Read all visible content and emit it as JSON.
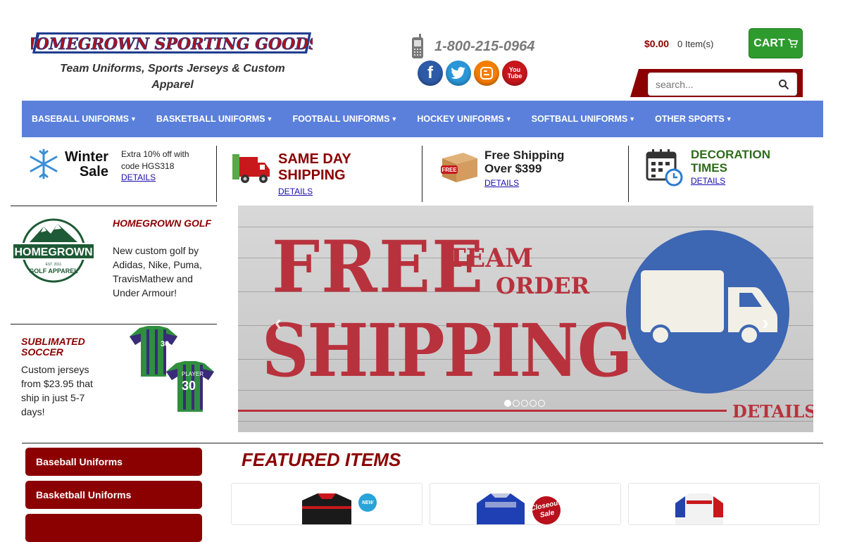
{
  "header": {
    "logo_text": "HOMEGROWN SPORTING GOODS",
    "tagline": "Team Uniforms, Sports Jerseys & Custom Apparel",
    "phone": "1-800-215-0964",
    "social": [
      {
        "name": "facebook",
        "glyph": "f"
      },
      {
        "name": "twitter",
        "glyph": "t"
      },
      {
        "name": "blogger",
        "glyph": "B"
      },
      {
        "name": "youtube",
        "glyph": "You Tube"
      }
    ],
    "cart_total": "$0.00",
    "cart_items": "0 Item(s)",
    "cart_label": "CART",
    "search_placeholder": "search..."
  },
  "nav": {
    "items": [
      {
        "label": "BASEBALL UNIFORMS"
      },
      {
        "label": "BASKETBALL UNIFORMS"
      },
      {
        "label": "FOOTBALL UNIFORMS"
      },
      {
        "label": "HOCKEY UNIFORMS"
      },
      {
        "label": "SOFTBALL UNIFORMS"
      },
      {
        "label": "OTHER SPORTS"
      }
    ]
  },
  "promos": {
    "winter": {
      "title": "Winter Sale",
      "text": "Extra 10% off with code HGS318",
      "link": "DETAILS"
    },
    "sameday": {
      "title": "SAME DAY SHIPPING",
      "link": "DETAILS"
    },
    "freeship": {
      "title": "Free Shipping Over $399",
      "link": "DETAILS",
      "box_label": "FREE"
    },
    "deco": {
      "title": "DECORATION TIMES",
      "link": "DETAILS"
    }
  },
  "left_promos": {
    "golf": {
      "title": "HOMEGROWN GOLF",
      "text": "New custom golf by Adidas, Nike, Puma, TravisMathew and Under Armour!",
      "logo_text": "HOMEGROWN",
      "logo_sub": "GOLF APPAREL",
      "logo_est": "EST. 2011"
    },
    "soccer": {
      "title": "SUBLIMATED SOCCER",
      "text": "Custom jerseys from $23.95 that ship in just 5-7 days!",
      "jersey_number": "30",
      "jersey_name": "PLAYER"
    }
  },
  "hero": {
    "line1": "FREE",
    "line2": "TEAM",
    "line3": "ORDER",
    "line4": "SHIPPING",
    "details": "DETAILS",
    "prev": "‹",
    "next": "›",
    "slide_count": 5,
    "active_slide": 1
  },
  "sidebar": {
    "items": [
      {
        "label": "Baseball Uniforms"
      },
      {
        "label": "Basketball Uniforms"
      },
      {
        "label": ""
      }
    ]
  },
  "featured": {
    "title": "FEATURED ITEMS",
    "badges": {
      "new": "NEW",
      "closeout": "Closeout Sale"
    }
  },
  "colors": {
    "brand_red": "#8b0000",
    "nav_blue": "#5b80db",
    "cart_green": "#2e9b2e"
  }
}
